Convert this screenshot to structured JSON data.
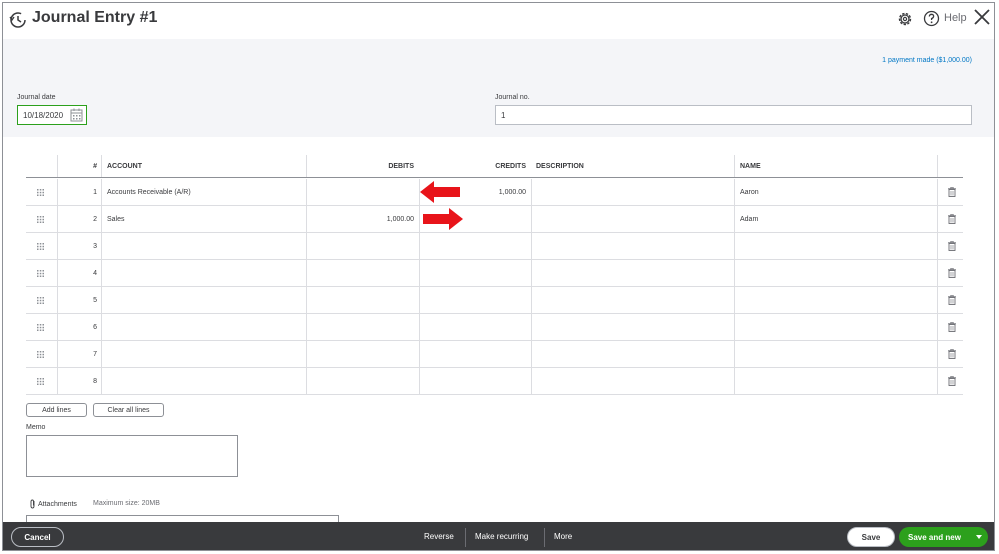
{
  "header": {
    "title": "Journal Entry #1",
    "help_label": "Help",
    "payment_link": "1 payment made ($1,000.00)"
  },
  "form": {
    "journal_date_label": "Journal date",
    "journal_date_value": "10/18/2020",
    "journal_no_label": "Journal no.",
    "journal_no_value": "1"
  },
  "table": {
    "columns": {
      "num": "#",
      "account": "ACCOUNT",
      "debits": "DEBITS",
      "credits": "CREDITS",
      "description": "DESCRIPTION",
      "name": "NAME"
    },
    "rows": [
      {
        "num": "1",
        "account": "Accounts Receivable (A/R)",
        "debits": "",
        "credits": "1,000.00",
        "description": "",
        "name": "Aaron"
      },
      {
        "num": "2",
        "account": "Sales",
        "debits": "1,000.00",
        "credits": "",
        "description": "",
        "name": "Adam"
      },
      {
        "num": "3",
        "account": "",
        "debits": "",
        "credits": "",
        "description": "",
        "name": ""
      },
      {
        "num": "4",
        "account": "",
        "debits": "",
        "credits": "",
        "description": "",
        "name": ""
      },
      {
        "num": "5",
        "account": "",
        "debits": "",
        "credits": "",
        "description": "",
        "name": ""
      },
      {
        "num": "6",
        "account": "",
        "debits": "",
        "credits": "",
        "description": "",
        "name": ""
      },
      {
        "num": "7",
        "account": "",
        "debits": "",
        "credits": "",
        "description": "",
        "name": ""
      },
      {
        "num": "8",
        "account": "",
        "debits": "",
        "credits": "",
        "description": "",
        "name": ""
      }
    ]
  },
  "buttons": {
    "add_lines": "Add lines",
    "clear_all_lines": "Clear all lines"
  },
  "memo": {
    "label": "Memo",
    "value": ""
  },
  "attachments": {
    "label": "Attachments",
    "max_size": "Maximum size: 20MB"
  },
  "footer": {
    "cancel": "Cancel",
    "reverse": "Reverse",
    "make_recurring": "Make recurring",
    "more": "More",
    "save": "Save",
    "save_and_new": "Save and new"
  },
  "colors": {
    "accent_green": "#2ca01c",
    "link_blue": "#0077c5",
    "footer_bg": "#393a3d",
    "annotation_arrow": "#e8141a"
  },
  "icons": {
    "title": "journal-history-icon",
    "settings": "gear-icon",
    "help": "help-circle-icon",
    "close": "close-icon",
    "calendar": "calendar-icon",
    "drag": "drag-handle-icon",
    "delete": "trash-icon",
    "attachment": "paperclip-icon"
  }
}
